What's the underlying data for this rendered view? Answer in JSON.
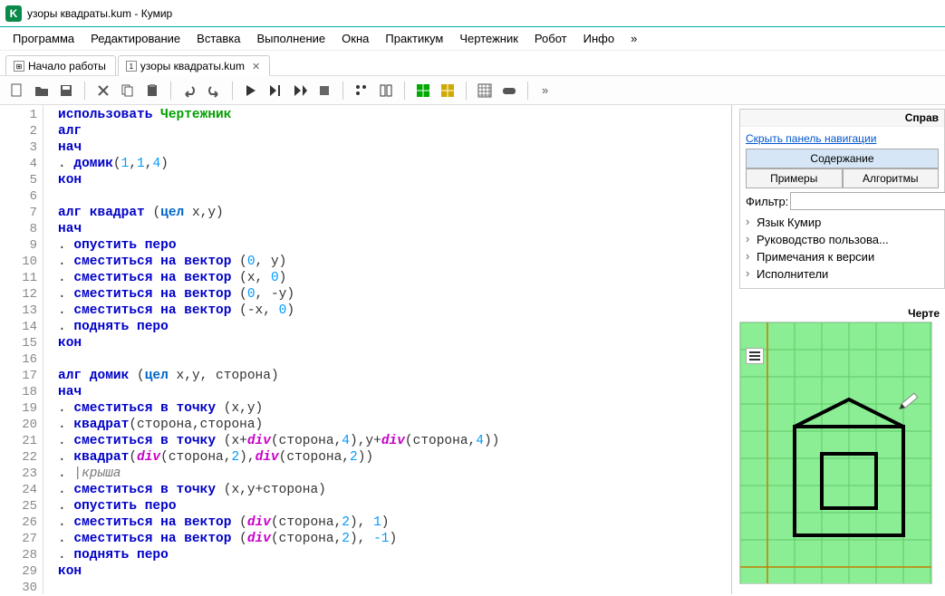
{
  "title": "узоры квадраты.kum - Кумир",
  "app_icon_letter": "K",
  "menu": [
    "Программа",
    "Редактирование",
    "Вставка",
    "Выполнение",
    "Окна",
    "Практикум",
    "Чертежник",
    "Робот",
    "Инфо",
    "»"
  ],
  "tabs": [
    {
      "label": "Начало работы",
      "closable": false
    },
    {
      "label": "узоры квадраты.kum",
      "closable": true,
      "active": true
    }
  ],
  "code": {
    "lines": 30,
    "l1_kw": "использовать",
    "l1_exec": "Чертежник",
    "l2": "алг",
    "l3": "нач",
    "l4_call": "домик",
    "l4_args": [
      "1",
      "1",
      "4"
    ],
    "l5": "кон",
    "l7_kw": "алг",
    "l7_name": "квадрат",
    "l7_type": "цел",
    "l7_params": " x,y",
    "l8": "нач",
    "l9": "опустить перо",
    "l10_cmd": "сместиться на вектор",
    "l10_a": "0",
    "l10_b": "y",
    "l11_cmd": "сместиться на вектор",
    "l11_a": "x",
    "l11_b": "0",
    "l12_cmd": "сместиться на вектор",
    "l12_a": "0",
    "l12_b": "-y",
    "l13_cmd": "сместиться на вектор",
    "l13_a": "-x",
    "l13_b": "0",
    "l14": "поднять перо",
    "l15": "кон",
    "l17_kw": "алг",
    "l17_name": "домик",
    "l17_type": "цел",
    "l17_params": " x,y, сторона",
    "l18": "нач",
    "l19_cmd": "сместиться в точку",
    "l19_rest": " (x,y)",
    "l20_cmd": "квадрат",
    "l20_rest": "(сторона,сторона)",
    "l21_cmd": "сместиться в точку",
    "l21_pref": " (x+",
    "l21_div": "div",
    "l21_mid1": "(сторона,",
    "l21_n1": "4",
    "l21_mid2": "),y+",
    "l21_mid3": "(сторона,",
    "l21_n2": "4",
    "l21_end": "))",
    "l22_cmd": "квадрат",
    "l22_pref": "(",
    "l22_div": "div",
    "l22_mid1": "(сторона,",
    "l22_n1": "2",
    "l22_mid2": "),",
    "l22_mid3": "(сторона,",
    "l22_n2": "2",
    "l22_end": "))",
    "l23": "крыша",
    "l24_cmd": "сместиться в точку",
    "l24_rest": " (x,y+сторона)",
    "l25": "опустить перо",
    "l26_cmd": "сместиться на вектор",
    "l26_pref": " (",
    "l26_div": "div",
    "l26_mid": "(сторона,",
    "l26_n1": "2",
    "l26_mid2": "), ",
    "l26_n2": "1",
    "l26_end": ")",
    "l27_cmd": "сместиться на вектор",
    "l27_pref": " (",
    "l27_div": "div",
    "l27_mid": "(сторона,",
    "l27_n1": "2",
    "l27_mid2": "), ",
    "l27_n2": "-1",
    "l27_end": ")",
    "l28": "поднять перо",
    "l29": "кон"
  },
  "help": {
    "title": "Справ",
    "hide_link": "Скрыть панель навигации",
    "tabs": {
      "content": "Содержание",
      "examples": "Примеры",
      "algorithms": "Алгоритмы"
    },
    "filter_label": "Фильтр:",
    "tree": [
      "Язык Кумир",
      "Руководство пользова...",
      "Примечания к версии",
      "Исполнители"
    ]
  },
  "drawer": {
    "title": "Черте"
  }
}
